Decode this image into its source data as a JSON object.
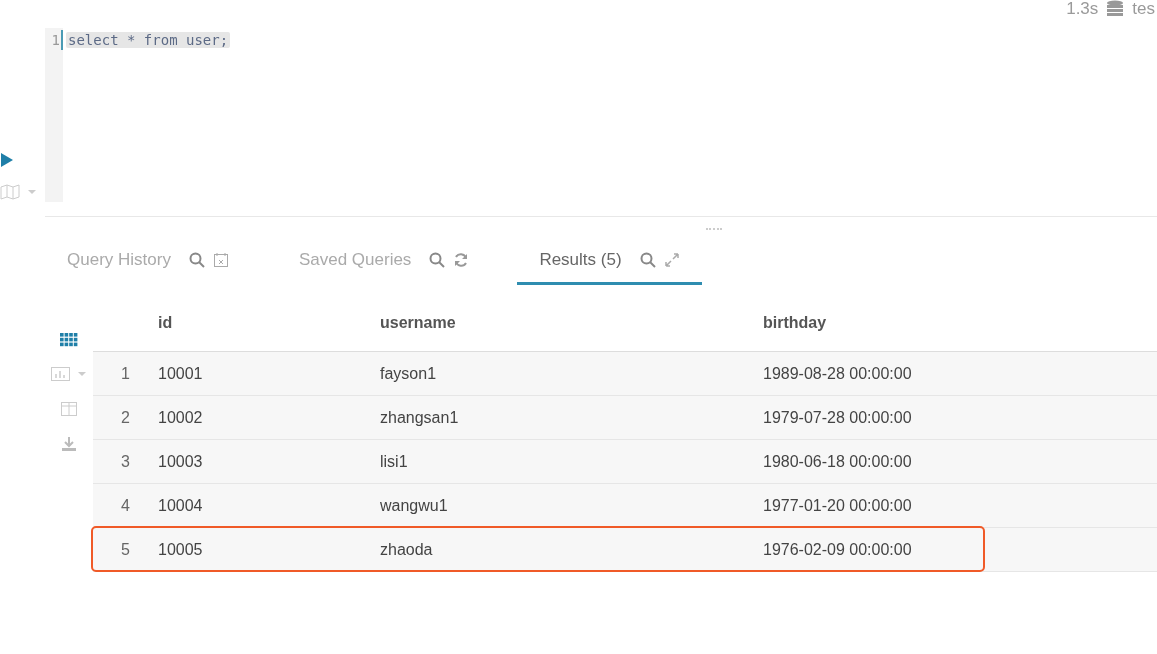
{
  "status": {
    "duration": "1.3s",
    "database": "tes"
  },
  "editor": {
    "lines": [
      {
        "number": "1",
        "code": "select * from user;"
      }
    ]
  },
  "tabs": [
    {
      "label": "Query History",
      "selected": false,
      "kind": "history"
    },
    {
      "label": "Saved Queries",
      "selected": false,
      "kind": "saved"
    },
    {
      "label": "Results (5)",
      "selected": true,
      "kind": "results"
    }
  ],
  "table": {
    "columns": [
      "id",
      "username",
      "birthday"
    ],
    "rows": [
      {
        "index": "1",
        "cells": [
          "10001",
          "fayson1",
          "1989-08-28 00:00:00"
        ],
        "highlighted": false
      },
      {
        "index": "2",
        "cells": [
          "10002",
          "zhangsan1",
          "1979-07-28 00:00:00"
        ],
        "highlighted": false
      },
      {
        "index": "3",
        "cells": [
          "10003",
          "lisi1",
          "1980-06-18 00:00:00"
        ],
        "highlighted": false
      },
      {
        "index": "4",
        "cells": [
          "10004",
          "wangwu1",
          "1977-01-20 00:00:00"
        ],
        "highlighted": false
      },
      {
        "index": "5",
        "cells": [
          "10005",
          "zhaoda",
          "1976-02-09 00:00:00"
        ],
        "highlighted": true
      }
    ]
  }
}
